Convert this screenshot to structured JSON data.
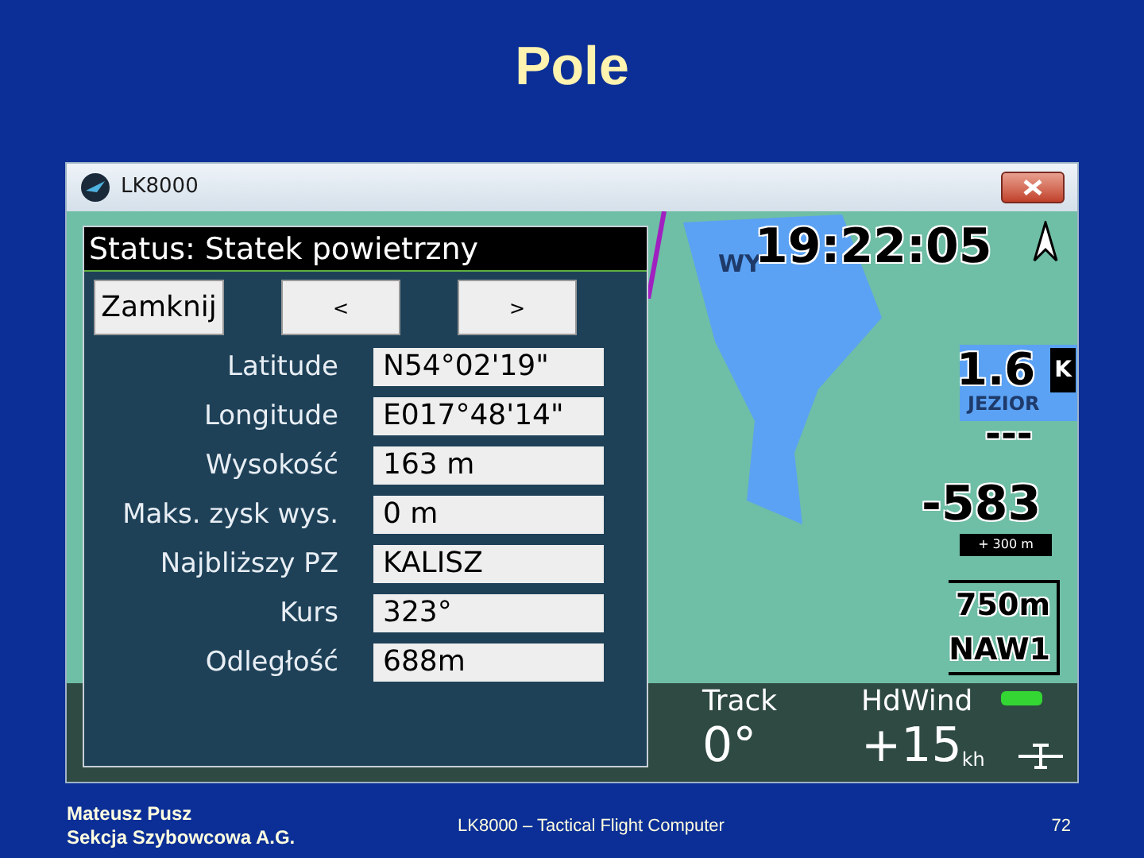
{
  "slide": {
    "title": "Pole",
    "footer": {
      "author": [
        "Mateusz Pusz",
        "Sekcja Szybowcowa A.G."
      ],
      "center": "LK8000 – Tactical Flight Computer",
      "page": "72"
    }
  },
  "window": {
    "title": "LK8000"
  },
  "map": {
    "labels": [
      "WY",
      "JEZIOR"
    ],
    "clock": "19:22:05",
    "distance": "1.6",
    "distance_unit": "K",
    "dashes": "---",
    "altitude_diff": "-583",
    "altitude_note": "+ 300 m",
    "next_waypoint": [
      "750m",
      "NAW1"
    ],
    "bottom": [
      {
        "label": "Track",
        "value": "0°"
      },
      {
        "label": "HdWind",
        "value": "+15",
        "unit": "kh"
      }
    ]
  },
  "dialog": {
    "title": "Status: Statek powietrzny",
    "buttons": [
      "Zamknij",
      "<",
      ">"
    ],
    "fields": [
      {
        "label": "Latitude",
        "value": "N54°02'19\""
      },
      {
        "label": "Longitude",
        "value": "E017°48'14\""
      },
      {
        "label": "Wysokość",
        "value": "163 m"
      },
      {
        "label": "Maks. zysk wys.",
        "value": "0 m"
      },
      {
        "label": "Najbliższy PZ",
        "value": "KALISZ"
      },
      {
        "label": "Kurs",
        "value": "323°"
      },
      {
        "label": "Odległość",
        "value": "688m"
      }
    ]
  }
}
